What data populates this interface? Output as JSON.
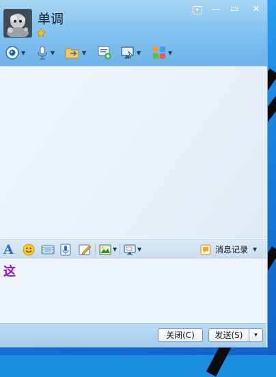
{
  "contact": {
    "name": "单调"
  },
  "window_controls": {
    "menu": "▾",
    "minimize": "—",
    "maximize": "▭",
    "close": "✕"
  },
  "toolbar_top": {
    "icons": [
      "video-call-icon",
      "voice-call-icon",
      "file-transfer-icon",
      "message-mgmt-icon",
      "remote-assist-icon",
      "apps-icon"
    ]
  },
  "format_toolbar": {
    "font_icon": "A",
    "history_label": "消息记录"
  },
  "input": {
    "text": "这"
  },
  "buttons": {
    "close_label": "关闭(C)",
    "send_label": "发送(S)",
    "send_menu": "▾"
  }
}
